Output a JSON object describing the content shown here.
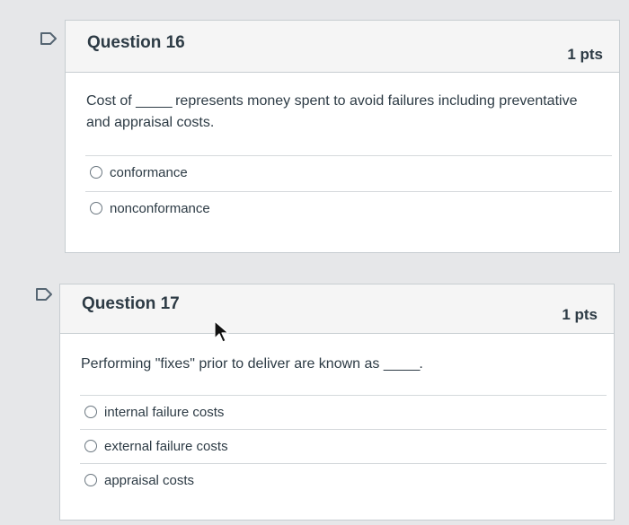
{
  "questions": [
    {
      "title": "Question 16",
      "points": "1 pts",
      "text_before": "Cost of",
      "blank": "_____",
      "text_after": "represents money spent to avoid failures including preventative",
      "text_line2": "and appraisal costs.",
      "answers": [
        "conformance",
        "nonconformance"
      ]
    },
    {
      "title": "Question 17",
      "points": "1 pts",
      "text_before": "Performing \"fixes\" prior to deliver are known as",
      "blank": "_____.",
      "answers": [
        "internal failure costs",
        "external failure costs",
        "appraisal costs"
      ]
    }
  ],
  "icons": {
    "flag": "flag-outline-icon",
    "cursor": "mouse-pointer-icon"
  },
  "colors": {
    "background": "#e6e7e9",
    "card": "#ffffff",
    "header": "#f5f5f5",
    "text": "#2d3b45",
    "border": "#c7cdd1"
  }
}
